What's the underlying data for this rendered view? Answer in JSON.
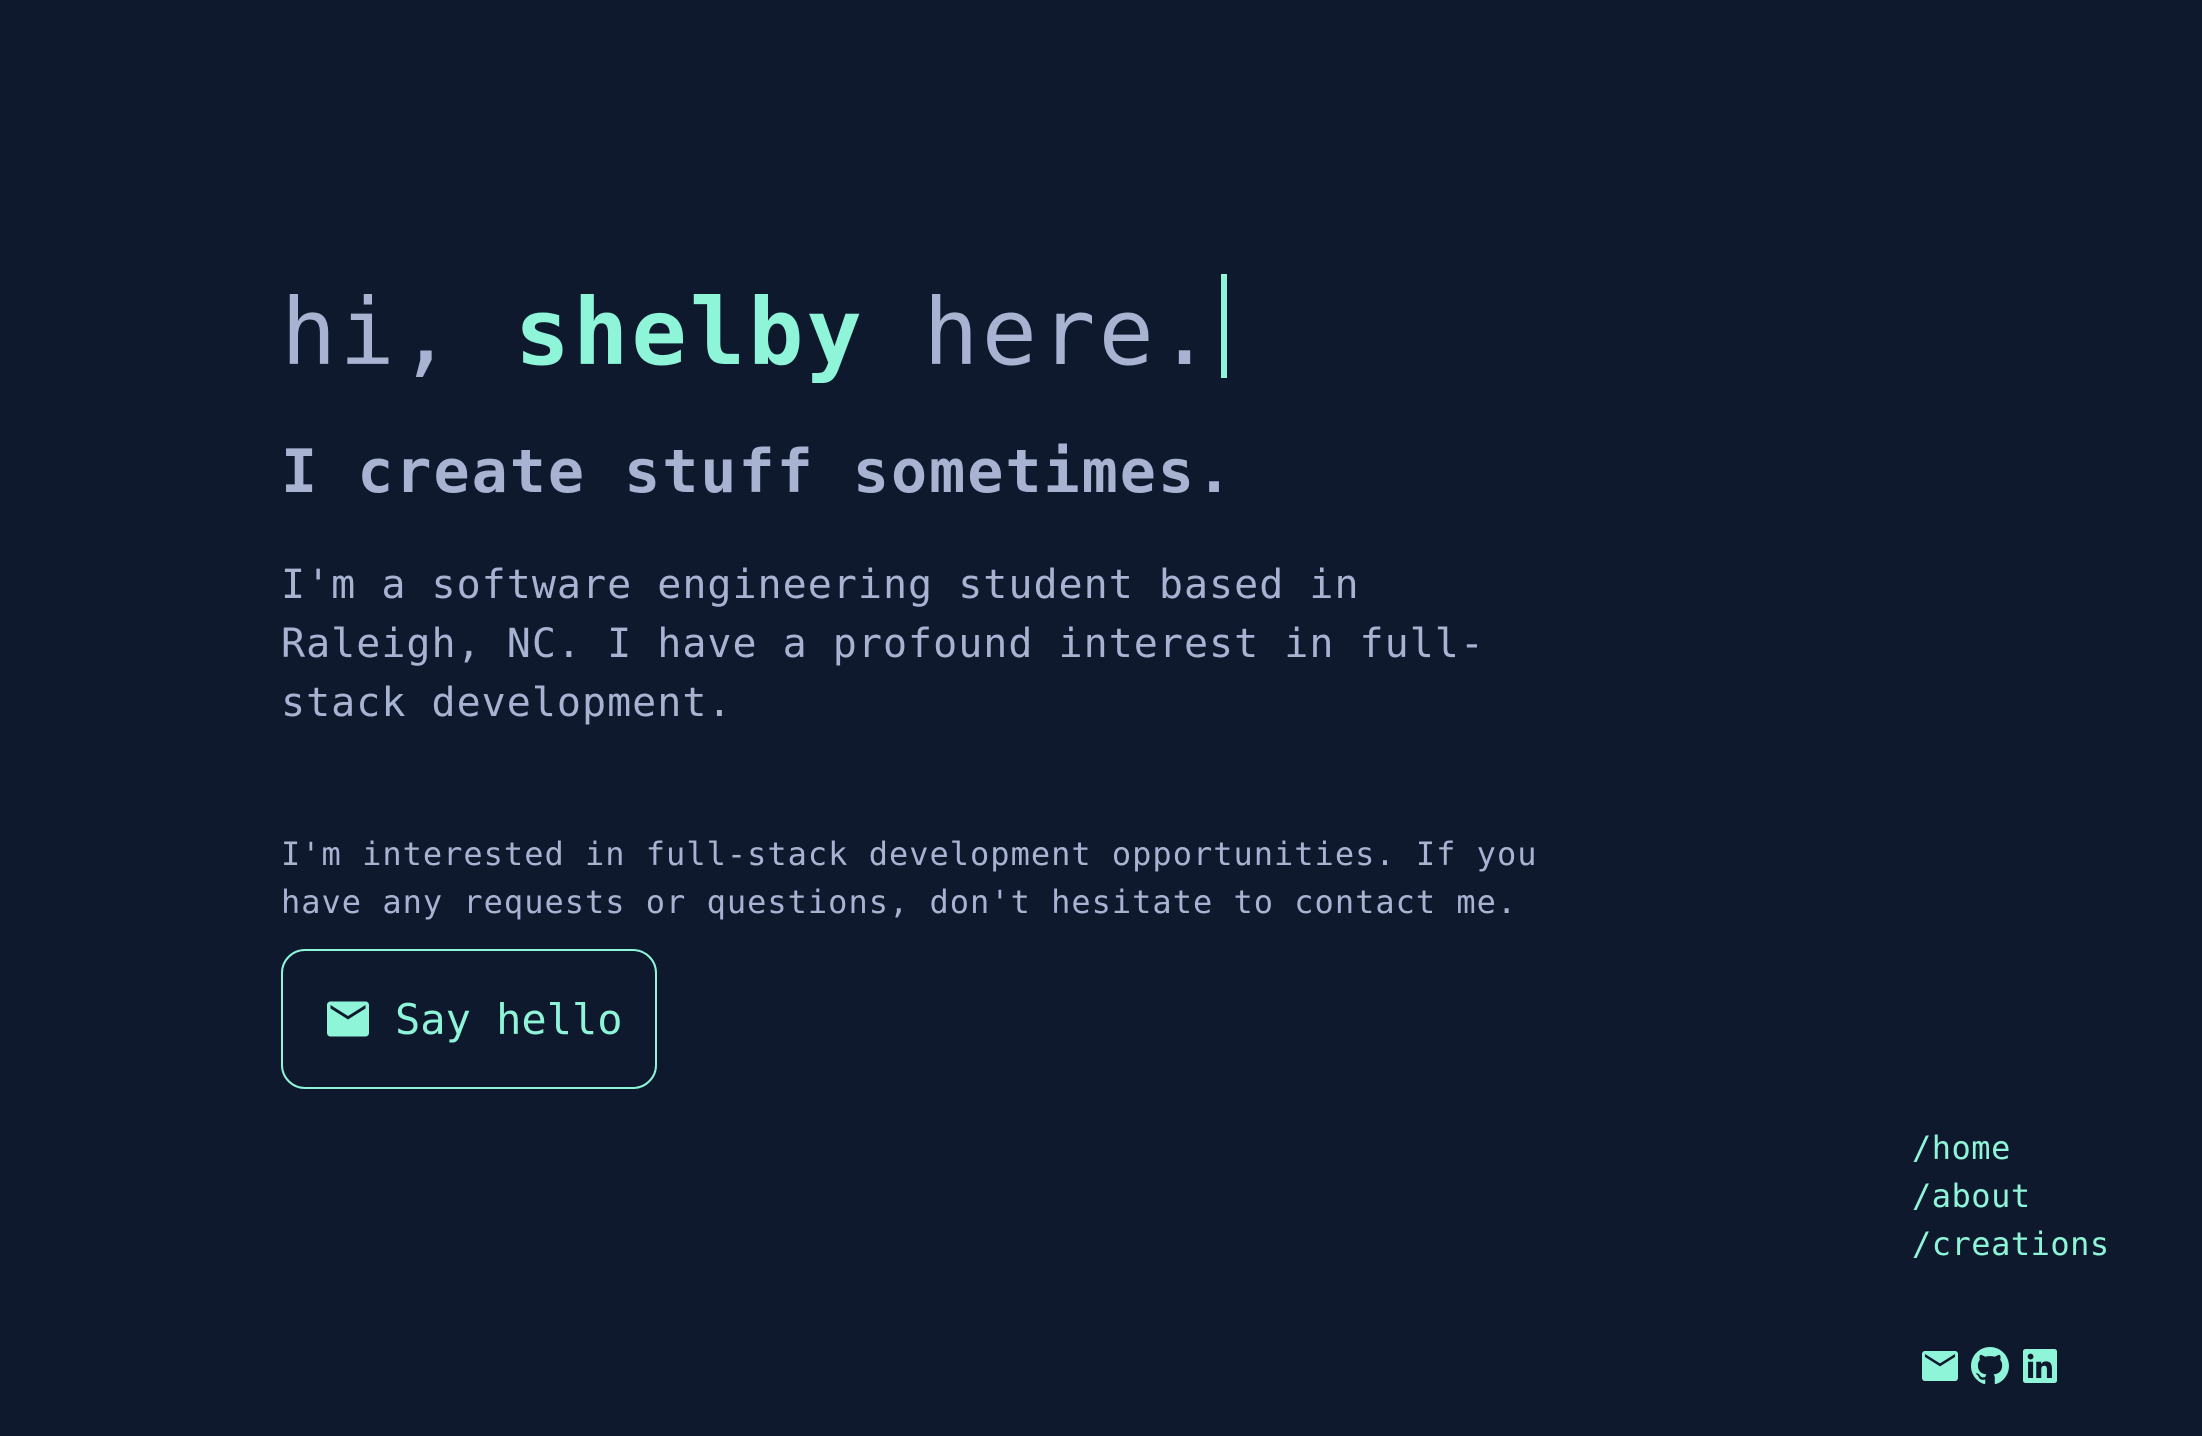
{
  "hero": {
    "greeting_prefix": "hi, ",
    "name": "shelby",
    "greeting_suffix": " here.",
    "tagline": "I create stuff sometimes.",
    "intro_lines": [
      "I'm a software engineering student based in",
      "Raleigh, NC. I have a profound interest in full-",
      "stack development."
    ],
    "contact_note_lines": [
      "I'm interested in full-stack development opportunities. If you",
      "have any requests or questions, don't hesitate to contact me."
    ],
    "cta": {
      "label": "Say hello",
      "icon": "mail-icon"
    }
  },
  "nav": {
    "items": [
      {
        "label": "/home"
      },
      {
        "label": "/about"
      },
      {
        "label": "/creations"
      }
    ]
  },
  "socials": [
    {
      "icon": "mail-icon"
    },
    {
      "icon": "github-icon"
    },
    {
      "icon": "linkedin-icon"
    }
  ],
  "colors": {
    "background": "#0e192d",
    "text": "#a8b2d1",
    "accent": "#8ff5d9"
  }
}
